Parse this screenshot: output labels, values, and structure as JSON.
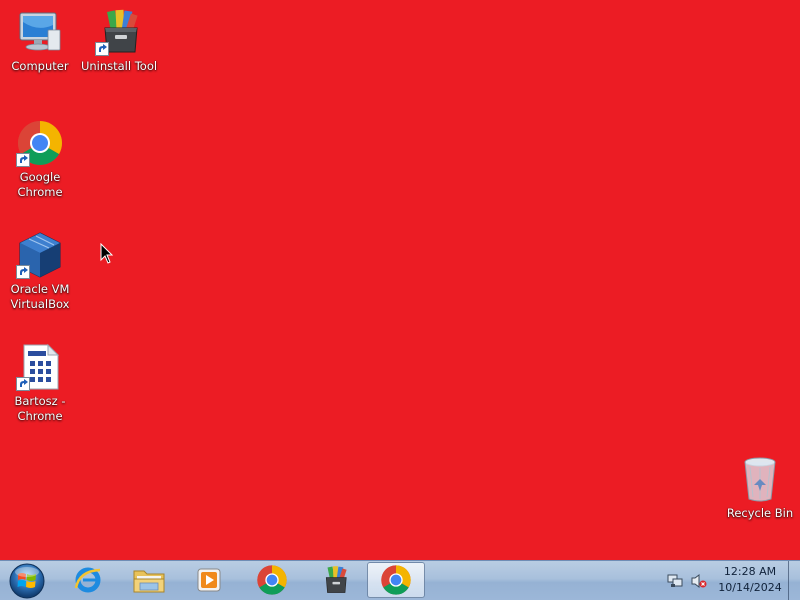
{
  "desktop": {
    "background_color": "#ec1c24",
    "icons": [
      {
        "label": "Computer",
        "icon": "computer-icon",
        "shortcut": false
      },
      {
        "label": "Uninstall Tool",
        "icon": "uninstall-tool-icon",
        "shortcut": true
      },
      {
        "label": "Google Chrome",
        "icon": "chrome-icon",
        "shortcut": true
      },
      {
        "label": "Oracle VM VirtualBox",
        "icon": "virtualbox-icon",
        "shortcut": true
      },
      {
        "label": "Bartosz - Chrome",
        "icon": "chrome-app-document-icon",
        "shortcut": true
      },
      {
        "label": "Recycle Bin",
        "icon": "recycle-bin-icon",
        "shortcut": false
      }
    ]
  },
  "taskbar": {
    "start_icon": "windows-start-orb-icon",
    "pinned": [
      {
        "icon": "internet-explorer-icon",
        "active": false
      },
      {
        "icon": "file-explorer-icon",
        "active": false
      },
      {
        "icon": "media-player-icon",
        "active": false
      },
      {
        "icon": "chrome-icon",
        "active": false
      },
      {
        "icon": "uninstall-tool-icon",
        "active": false
      },
      {
        "icon": "chrome-icon",
        "active": true
      }
    ],
    "tray": {
      "icons": [
        "network-icon",
        "volume-muted-icon"
      ],
      "time": "12:28 AM",
      "date": "10/14/2024"
    }
  }
}
